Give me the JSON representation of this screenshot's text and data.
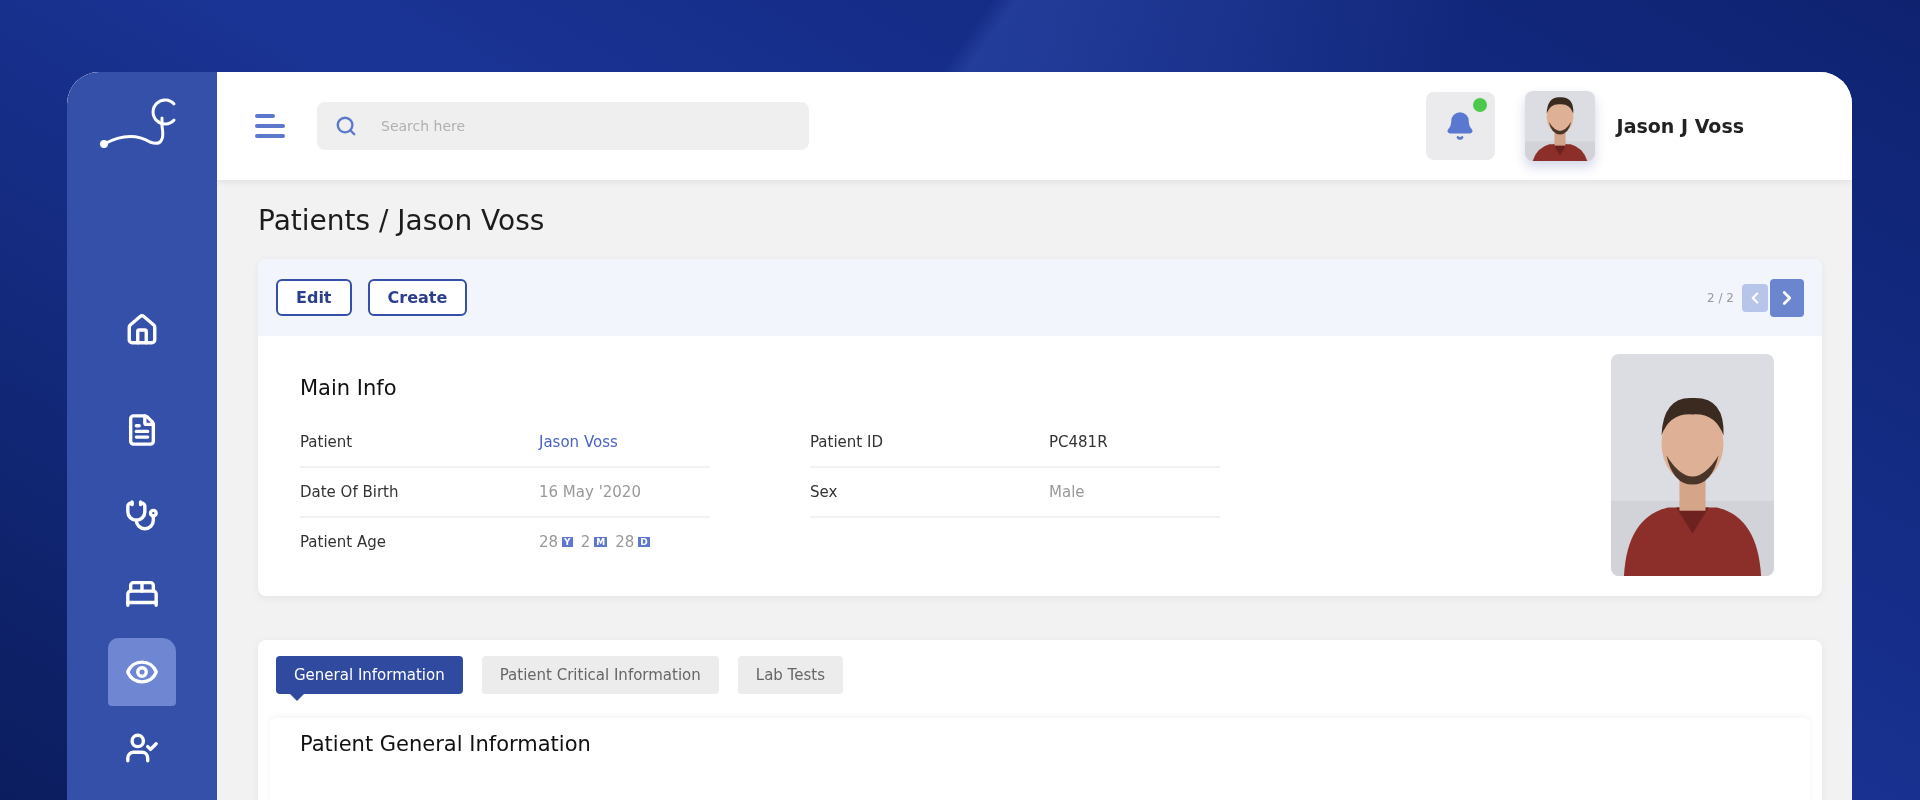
{
  "sidebar": {
    "items": [
      {
        "kind": "home",
        "selected": false
      },
      {
        "kind": "document",
        "selected": false
      },
      {
        "kind": "doctor",
        "selected": false
      },
      {
        "kind": "bed",
        "selected": false
      },
      {
        "kind": "eye",
        "selected": true
      },
      {
        "kind": "user-check",
        "selected": false
      }
    ]
  },
  "topbar": {
    "search": {
      "placeholder": "Search here"
    },
    "notifications": {
      "unread": true
    },
    "user": {
      "name": "Jason J Voss",
      "avatar": {
        "kind": "picture"
      }
    }
  },
  "breadcrumb": "Patients / Jason Voss",
  "record": {
    "actions": [
      "Edit",
      "Create"
    ],
    "pager": {
      "text": "2 / 2",
      "prev_disabled": true,
      "next_disabled": false
    },
    "main_info": {
      "title": "Main Info",
      "left": [
        {
          "label": "Patient",
          "value": "Jason Voss",
          "kind": "link"
        },
        {
          "label": "Date Of Birth",
          "value": "16 May '2020",
          "kind": "muted"
        },
        {
          "label": "Patient Age",
          "kind": "age",
          "parts": [
            {
              "value": "28",
              "unit": "Y"
            },
            {
              "value": "2",
              "unit": "M"
            },
            {
              "value": "28",
              "unit": "D"
            }
          ]
        }
      ],
      "right": [
        {
          "label": "Patient ID",
          "value": "PC481R",
          "kind": "plain"
        },
        {
          "label": "Sex",
          "value": "Male",
          "kind": "muted"
        }
      ]
    },
    "photo": {
      "kind": "picture"
    }
  },
  "details": {
    "tabs": [
      {
        "label": "General Information",
        "selected": true
      },
      {
        "label": "Patient Critical Information",
        "selected": false
      },
      {
        "label": "Lab Tests",
        "selected": false
      }
    ],
    "section_title": "Patient General Information"
  }
}
